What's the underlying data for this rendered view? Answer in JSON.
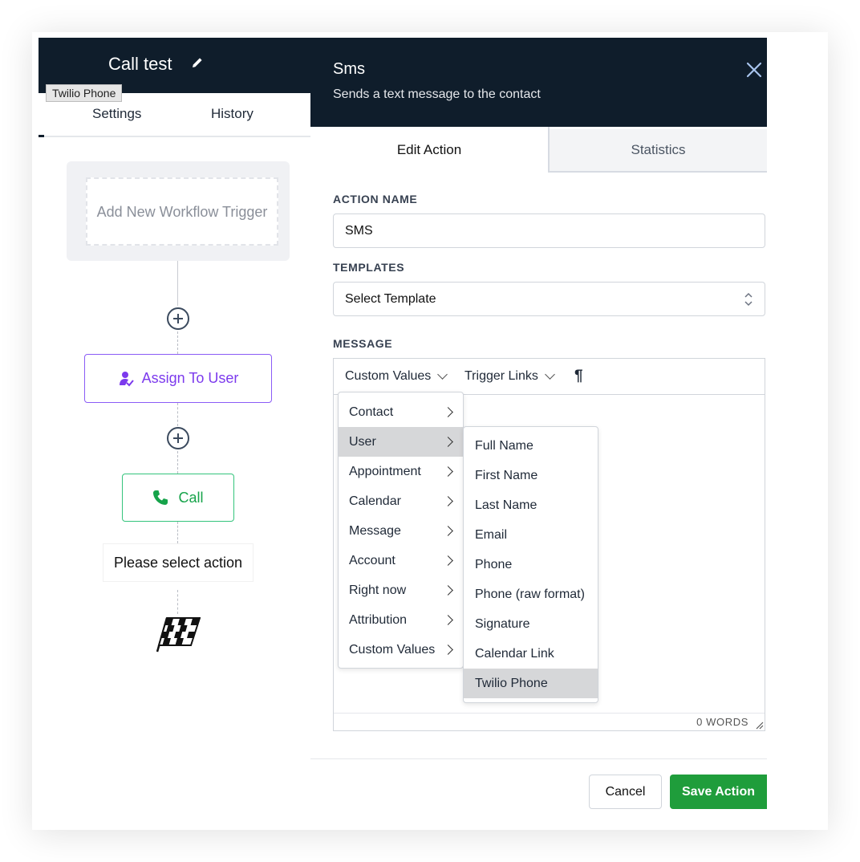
{
  "workflow": {
    "title": "Call test",
    "tooltip": "Twilio Phone",
    "tabs": [
      "Settings",
      "History"
    ],
    "trigger_placeholder": "Add New Workflow Trigger",
    "nodes": {
      "assign": "Assign To User",
      "call": "Call",
      "please_select": "Please select action"
    }
  },
  "action_panel": {
    "title": "Sms",
    "subtitle": "Sends a text message to the contact",
    "tabs": {
      "edit": "Edit Action",
      "statistics": "Statistics"
    },
    "action_name_label": "ACTION NAME",
    "action_name_value": "SMS",
    "templates_label": "TEMPLATES",
    "templates_value": "Select Template",
    "message_label": "MESSAGE",
    "toolbar": {
      "custom_values": "Custom Values",
      "trigger_links": "Trigger Links",
      "paragraph": "¶"
    },
    "word_count": "0 WORDS",
    "buttons": {
      "cancel": "Cancel",
      "save": "Save Action"
    }
  },
  "custom_values_menu": {
    "items": [
      "Contact",
      "User",
      "Appointment",
      "Calendar",
      "Message",
      "Account",
      "Right now",
      "Attribution",
      "Custom Values"
    ],
    "active": "User"
  },
  "user_submenu": {
    "items": [
      "Full Name",
      "First Name",
      "Last Name",
      "Email",
      "Phone",
      "Phone (raw format)",
      "Signature",
      "Calendar Link",
      "Twilio Phone"
    ],
    "active": "Twilio Phone"
  },
  "colors": {
    "header_bg": "#0f1d2b",
    "assign_purple": "#7c3aed",
    "call_green": "#16a34a",
    "save_green": "#1f9d3b",
    "menu_highlight": "#d6d7d9"
  }
}
